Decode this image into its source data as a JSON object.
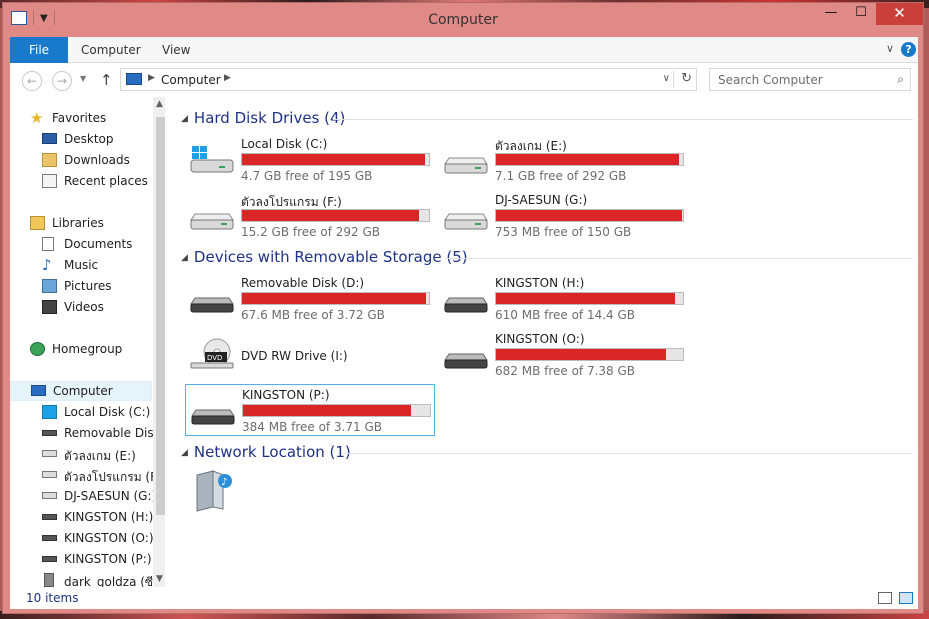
{
  "window": {
    "title": "Computer",
    "controls": {
      "minimize": "—",
      "maximize": "☐",
      "close": "✕"
    }
  },
  "ribbon": {
    "file": "File",
    "tabs": [
      "Computer",
      "View"
    ],
    "help": "?"
  },
  "address": {
    "crumb": "Computer",
    "search_placeholder": "Search Computer"
  },
  "nav": {
    "favorites": "Favorites",
    "desktop": "Desktop",
    "downloads": "Downloads",
    "recent": "Recent places",
    "libraries": "Libraries",
    "documents": "Documents",
    "music": "Music",
    "pictures": "Pictures",
    "videos": "Videos",
    "homegroup": "Homegroup",
    "computer": "Computer",
    "drives": [
      "Local Disk (C:)",
      "Removable Disk (",
      "ตัวลงเกม (E:)",
      "ตัวลงโปรแกรม (F:)",
      "DJ-SAESUN (G:)",
      "KINGSTON (H:)",
      "KINGSTON (O:)",
      "KINGSTON (P:)",
      "dark_goldza (ซี)"
    ]
  },
  "groups": {
    "hdd": "Hard Disk Drives (4)",
    "removable": "Devices with Removable Storage (5)",
    "network": "Network Location (1)"
  },
  "drives": {
    "c": {
      "name": "Local Disk (C:)",
      "free": "4.7 GB free of 195 GB",
      "used": 0.976
    },
    "e": {
      "name": "ตัวลงเกม (E:)",
      "free": "7.1 GB free of 292 GB",
      "used": 0.976
    },
    "f": {
      "name": "ตัวลงโปรแกรม (F:)",
      "free": "15.2 GB free of 292 GB",
      "used": 0.948
    },
    "g": {
      "name": "DJ-SAESUN (G:)",
      "free": "753 MB free of 150 GB",
      "used": 0.995
    },
    "d": {
      "name": "Removable Disk (D:)",
      "free": "67.6 MB free of 3.72 GB",
      "used": 0.982
    },
    "h": {
      "name": "KINGSTON (H:)",
      "free": "610 MB free of 14.4 GB",
      "used": 0.958
    },
    "i": {
      "name": "DVD RW Drive (I:)",
      "badge": "DVD"
    },
    "o": {
      "name": "KINGSTON (O:)",
      "free": "682 MB free of 7.38 GB",
      "used": 0.908
    },
    "p": {
      "name": "KINGSTON (P:)",
      "free": "384 MB free of 3.71 GB",
      "used": 0.897
    }
  },
  "status": {
    "count": "10 items"
  },
  "colors": {
    "bar_fill": "#da2626",
    "accent": "#1979ca",
    "window_frame": "#e08a87"
  }
}
